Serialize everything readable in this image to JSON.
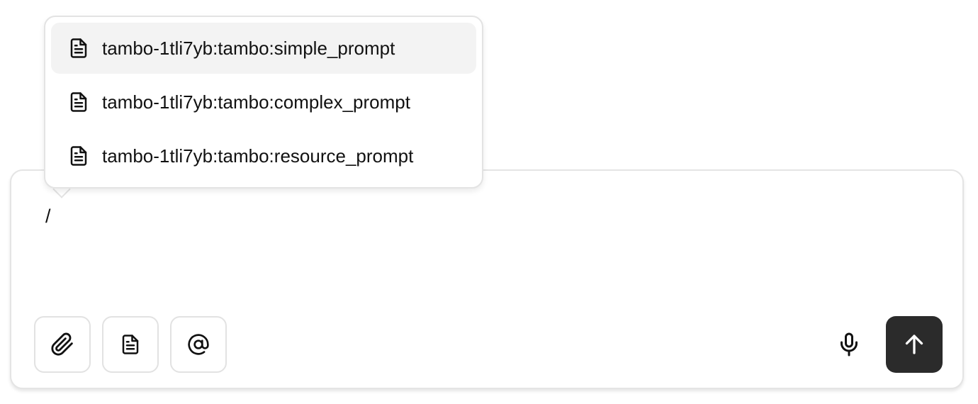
{
  "prompt_menu": {
    "items": [
      {
        "label": "tambo-1tli7yb:tambo:simple_prompt",
        "icon": "file-text-icon",
        "selected": true
      },
      {
        "label": "tambo-1tli7yb:tambo:complex_prompt",
        "icon": "file-text-icon",
        "selected": false
      },
      {
        "label": "tambo-1tli7yb:tambo:resource_prompt",
        "icon": "file-text-icon",
        "selected": false
      }
    ]
  },
  "composer": {
    "input_value": "/"
  },
  "toolbar": {
    "left_buttons": [
      "paperclip-icon",
      "file-text-icon",
      "at-sign-icon"
    ],
    "right_buttons": [
      "microphone-icon",
      "arrow-up-icon"
    ]
  },
  "colors": {
    "send_button_bg": "#2b2b2b",
    "selected_item_bg": "#f3f3f3",
    "border": "#e4e4e4"
  }
}
